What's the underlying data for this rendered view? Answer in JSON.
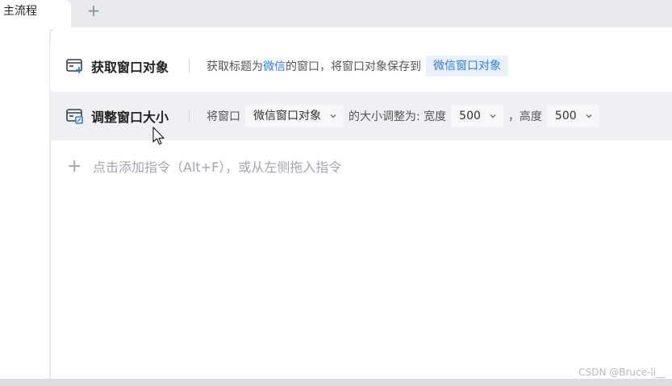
{
  "tabs": [
    {
      "label": "主流程",
      "active": true
    }
  ],
  "tab_add_label": "+",
  "commands": [
    {
      "icon": "window-add-icon",
      "title": "获取窗口对象",
      "desc_prefix": "获取标题为",
      "desc_link": "微信",
      "desc_middle": "的窗口，将窗口对象保存到",
      "variable": "微信窗口对象"
    },
    {
      "icon": "window-resize-icon",
      "title": "调整窗口大小",
      "desc_prefix": "将窗口",
      "window_select": "微信窗口对象",
      "desc_middle": "的大小调整为: 宽度",
      "width_select": "500",
      "desc_comma": "，高度",
      "height_select": "500"
    }
  ],
  "add_hint": {
    "plus": "+",
    "text": "点击添加指令（Alt+F），或从左侧拖入指令"
  },
  "watermark": "CSDN @Bruce-li__",
  "colors": {
    "accent": "#2a7de1",
    "pill_bg": "#e8f1fd",
    "selected_row_bg": "#eff0f3",
    "chrome_bg": "#e9eaee"
  }
}
